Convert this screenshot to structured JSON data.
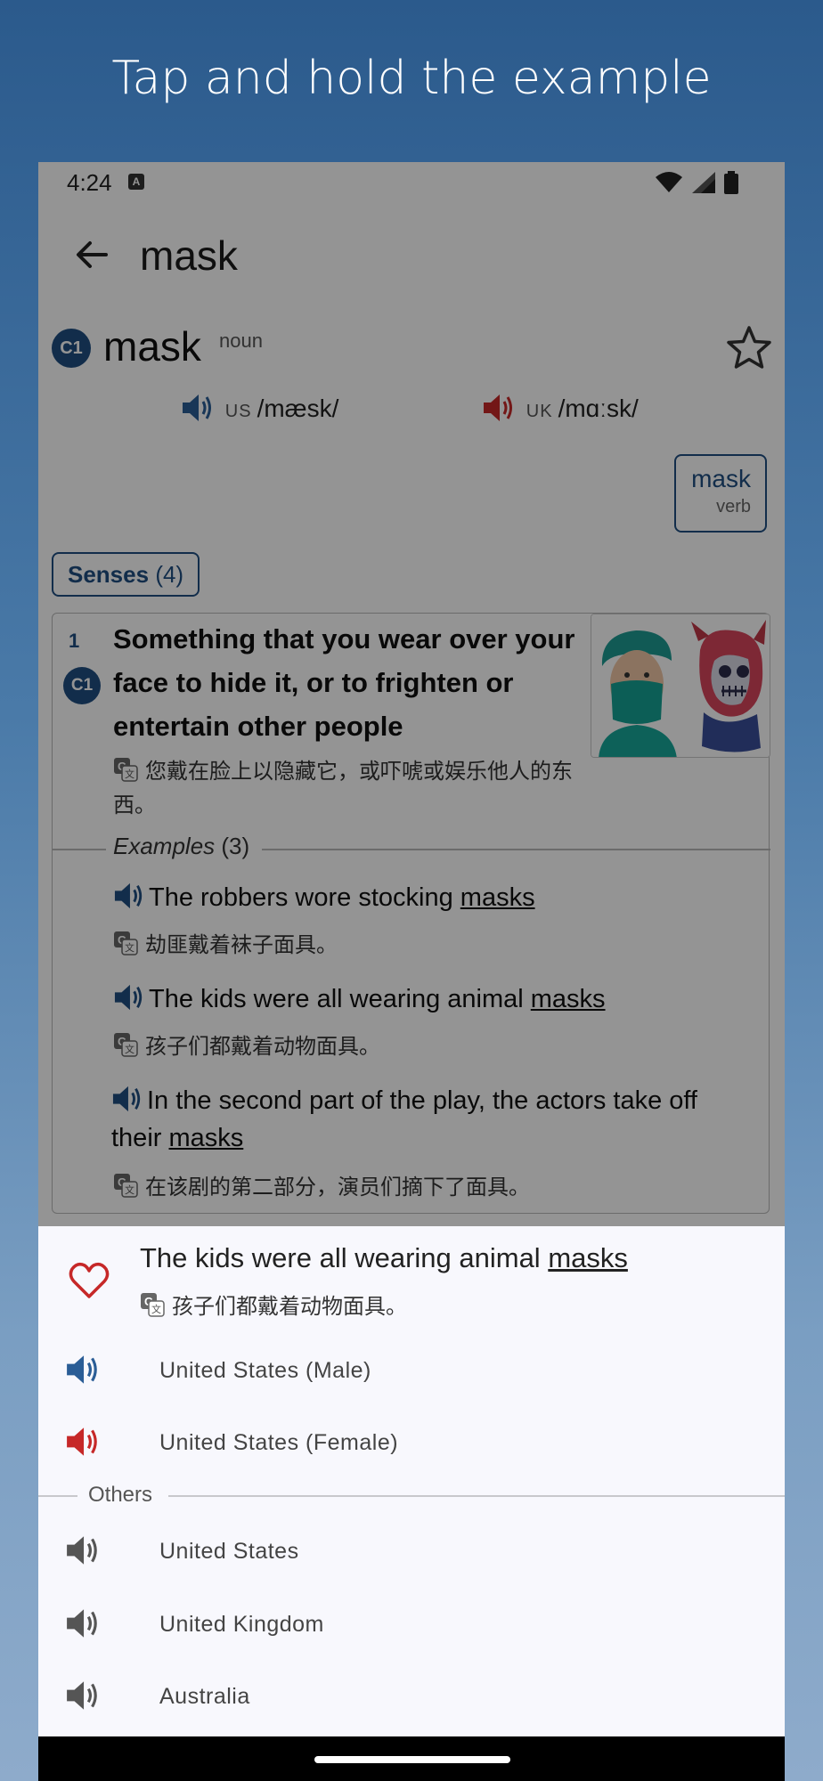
{
  "banner": {
    "text": "Tap and hold the example"
  },
  "status": {
    "time": "4:24",
    "notif_icon": "A"
  },
  "app_bar": {
    "title": "mask",
    "back_icon": "arrow-left-icon"
  },
  "entry": {
    "cefr": "C1",
    "headword": "mask",
    "pos": "noun",
    "pron_us": {
      "region": "US",
      "ipa": "/mæsk/",
      "color": "#2a5d96"
    },
    "pron_uk": {
      "region": "UK",
      "ipa": "/mɑːsk/",
      "color": "#c62828"
    },
    "related": {
      "word": "mask",
      "pos": "verb"
    },
    "senses_label": "Senses",
    "senses_count": "(4)"
  },
  "sense": {
    "number": "1",
    "cefr": "C1",
    "definition": "Something that you wear over your face to hide it, or to frighten or entertain other people",
    "translation": "您戴在脸上以隐藏它，或吓唬或娱乐他人的东西。",
    "examples_label": "Examples",
    "examples_count": "(3)",
    "examples": [
      {
        "pre": "The robbers wore stocking ",
        "link": "masks",
        "post": "",
        "translation": "劫匪戴着袜子面具。"
      },
      {
        "pre": "The kids were all wearing animal ",
        "link": "masks",
        "post": "",
        "translation": "孩子们都戴着动物面具。"
      },
      {
        "pre": "In the second part of the play, the actors take off their ",
        "link": "masks",
        "post": "",
        "translation": "在该剧的第二部分，演员们摘下了面具。"
      }
    ]
  },
  "sheet": {
    "sentence_pre": "The kids were all wearing animal ",
    "sentence_link": "masks",
    "translation": "孩子们都戴着动物面具。",
    "voices": [
      {
        "label": "United States (Male)",
        "color": "#2a5d96"
      },
      {
        "label": "United States (Female)",
        "color": "#c62828"
      }
    ],
    "others_label": "Others",
    "other_voices": [
      {
        "label": "United States"
      },
      {
        "label": "United Kingdom"
      },
      {
        "label": "Australia"
      }
    ],
    "heart_color": "#c62828"
  },
  "colors": {
    "brand": "#1f4f82",
    "accent_red": "#c62828"
  }
}
